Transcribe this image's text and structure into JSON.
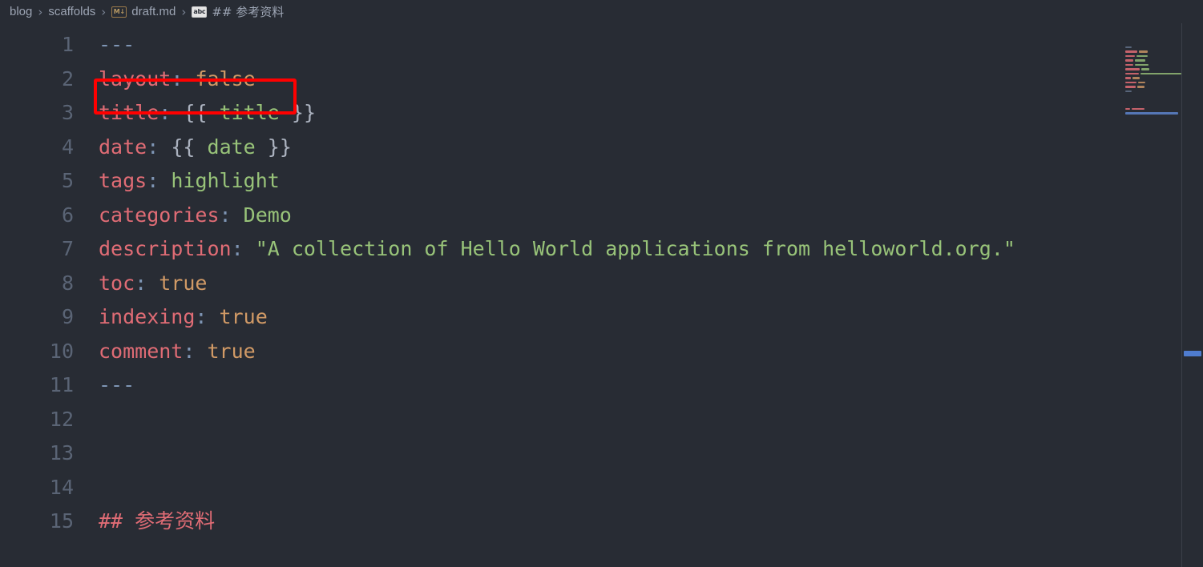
{
  "breadcrumb": {
    "items": [
      {
        "label": "blog",
        "icon": null
      },
      {
        "label": "scaffolds",
        "icon": null
      },
      {
        "label": "draft.md",
        "icon": "markdown-file-icon",
        "icon_text": "M↓"
      },
      {
        "label": "## 参考资料",
        "icon": "symbol-string-icon",
        "icon_text": "abc"
      }
    ],
    "separator": "›"
  },
  "editor": {
    "language": "markdown",
    "lines": [
      {
        "number": "1",
        "text": "---"
      },
      {
        "number": "2",
        "text": "layout: false"
      },
      {
        "number": "3",
        "text": "title: {{ title }}"
      },
      {
        "number": "4",
        "text": "date: {{ date }}"
      },
      {
        "number": "5",
        "text": "tags: highlight"
      },
      {
        "number": "6",
        "text": "categories: Demo"
      },
      {
        "number": "7",
        "text": "description: \"A collection of Hello World applications from helloworld.org.\""
      },
      {
        "number": "8",
        "text": "toc: true"
      },
      {
        "number": "9",
        "text": "indexing: true"
      },
      {
        "number": "10",
        "text": "comment: true"
      },
      {
        "number": "11",
        "text": "---"
      },
      {
        "number": "12",
        "text": ""
      },
      {
        "number": "13",
        "text": ""
      },
      {
        "number": "14",
        "text": ""
      },
      {
        "number": "15",
        "text": "## 参考资料"
      }
    ],
    "tokens": {
      "line1_dash": "---",
      "line2_key": "layout",
      "line2_colon": ":",
      "line2_value": "false",
      "line3_key": "title",
      "line3_colon": ":",
      "line3_open": "{{",
      "line3_var": "title",
      "line3_close": "}}",
      "line4_key": "date",
      "line4_colon": ":",
      "line4_open": "{{",
      "line4_var": "date",
      "line4_close": "}}",
      "line5_key": "tags",
      "line5_colon": ":",
      "line5_value": "highlight",
      "line6_key": "categories",
      "line6_colon": ":",
      "line6_value": "Demo",
      "line7_key": "description",
      "line7_colon": ":",
      "line7_value": "\"A collection of Hello World applications from helloworld.org.\"",
      "line8_key": "toc",
      "line8_colon": ":",
      "line8_value": "true",
      "line9_key": "indexing",
      "line9_colon": ":",
      "line9_value": "true",
      "line10_key": "comment",
      "line10_colon": ":",
      "line10_value": "true",
      "line11_dash": "---",
      "line15_hashes": "##",
      "line15_title": "参考资料"
    }
  },
  "annotation": {
    "type": "highlight-rectangle",
    "target_line": "2",
    "target_text": "layout: false",
    "color": "#ff0000"
  },
  "colors": {
    "background": "#282c34",
    "line_number": "#5a6475",
    "breadcrumb_text": "#9da5b4",
    "key": "#e06c75",
    "string": "#98c379",
    "boolean": "#d19a66",
    "punctuation": "#7f96b5",
    "default_text": "#abb2bf",
    "annotation": "#ff0000",
    "overview_marker": "#4f7ccf"
  }
}
